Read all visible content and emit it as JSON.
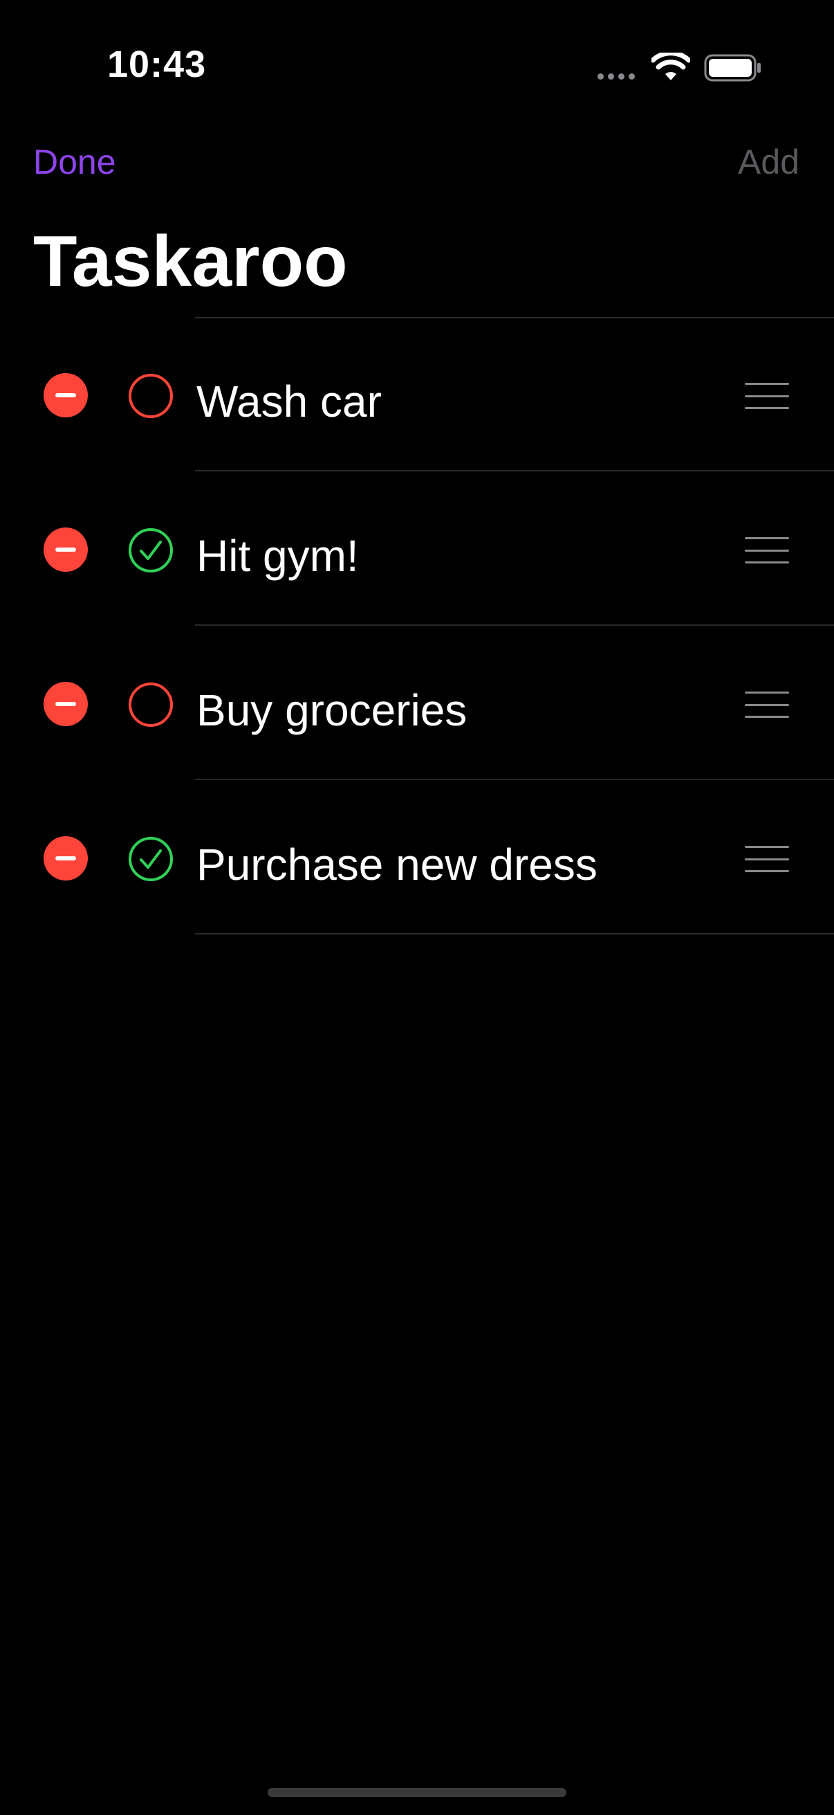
{
  "status_bar": {
    "time": "10:43",
    "icons": [
      "signal-dots-icon",
      "wifi-icon",
      "battery-icon"
    ]
  },
  "nav": {
    "done_label": "Done",
    "add_label": "Add"
  },
  "title": "Taskaroo",
  "tasks": [
    {
      "label": "Wash car",
      "done": false
    },
    {
      "label": "Hit gym!",
      "done": true
    },
    {
      "label": "Buy groceries",
      "done": false
    },
    {
      "label": "Purchase new dress",
      "done": true
    }
  ],
  "colors": {
    "accent": "#8e44ec",
    "disabled": "#5a5a5e",
    "delete": "#ff453a",
    "done_check": "#30d158",
    "pending_circle": "#ff453a",
    "background": "#000000"
  }
}
